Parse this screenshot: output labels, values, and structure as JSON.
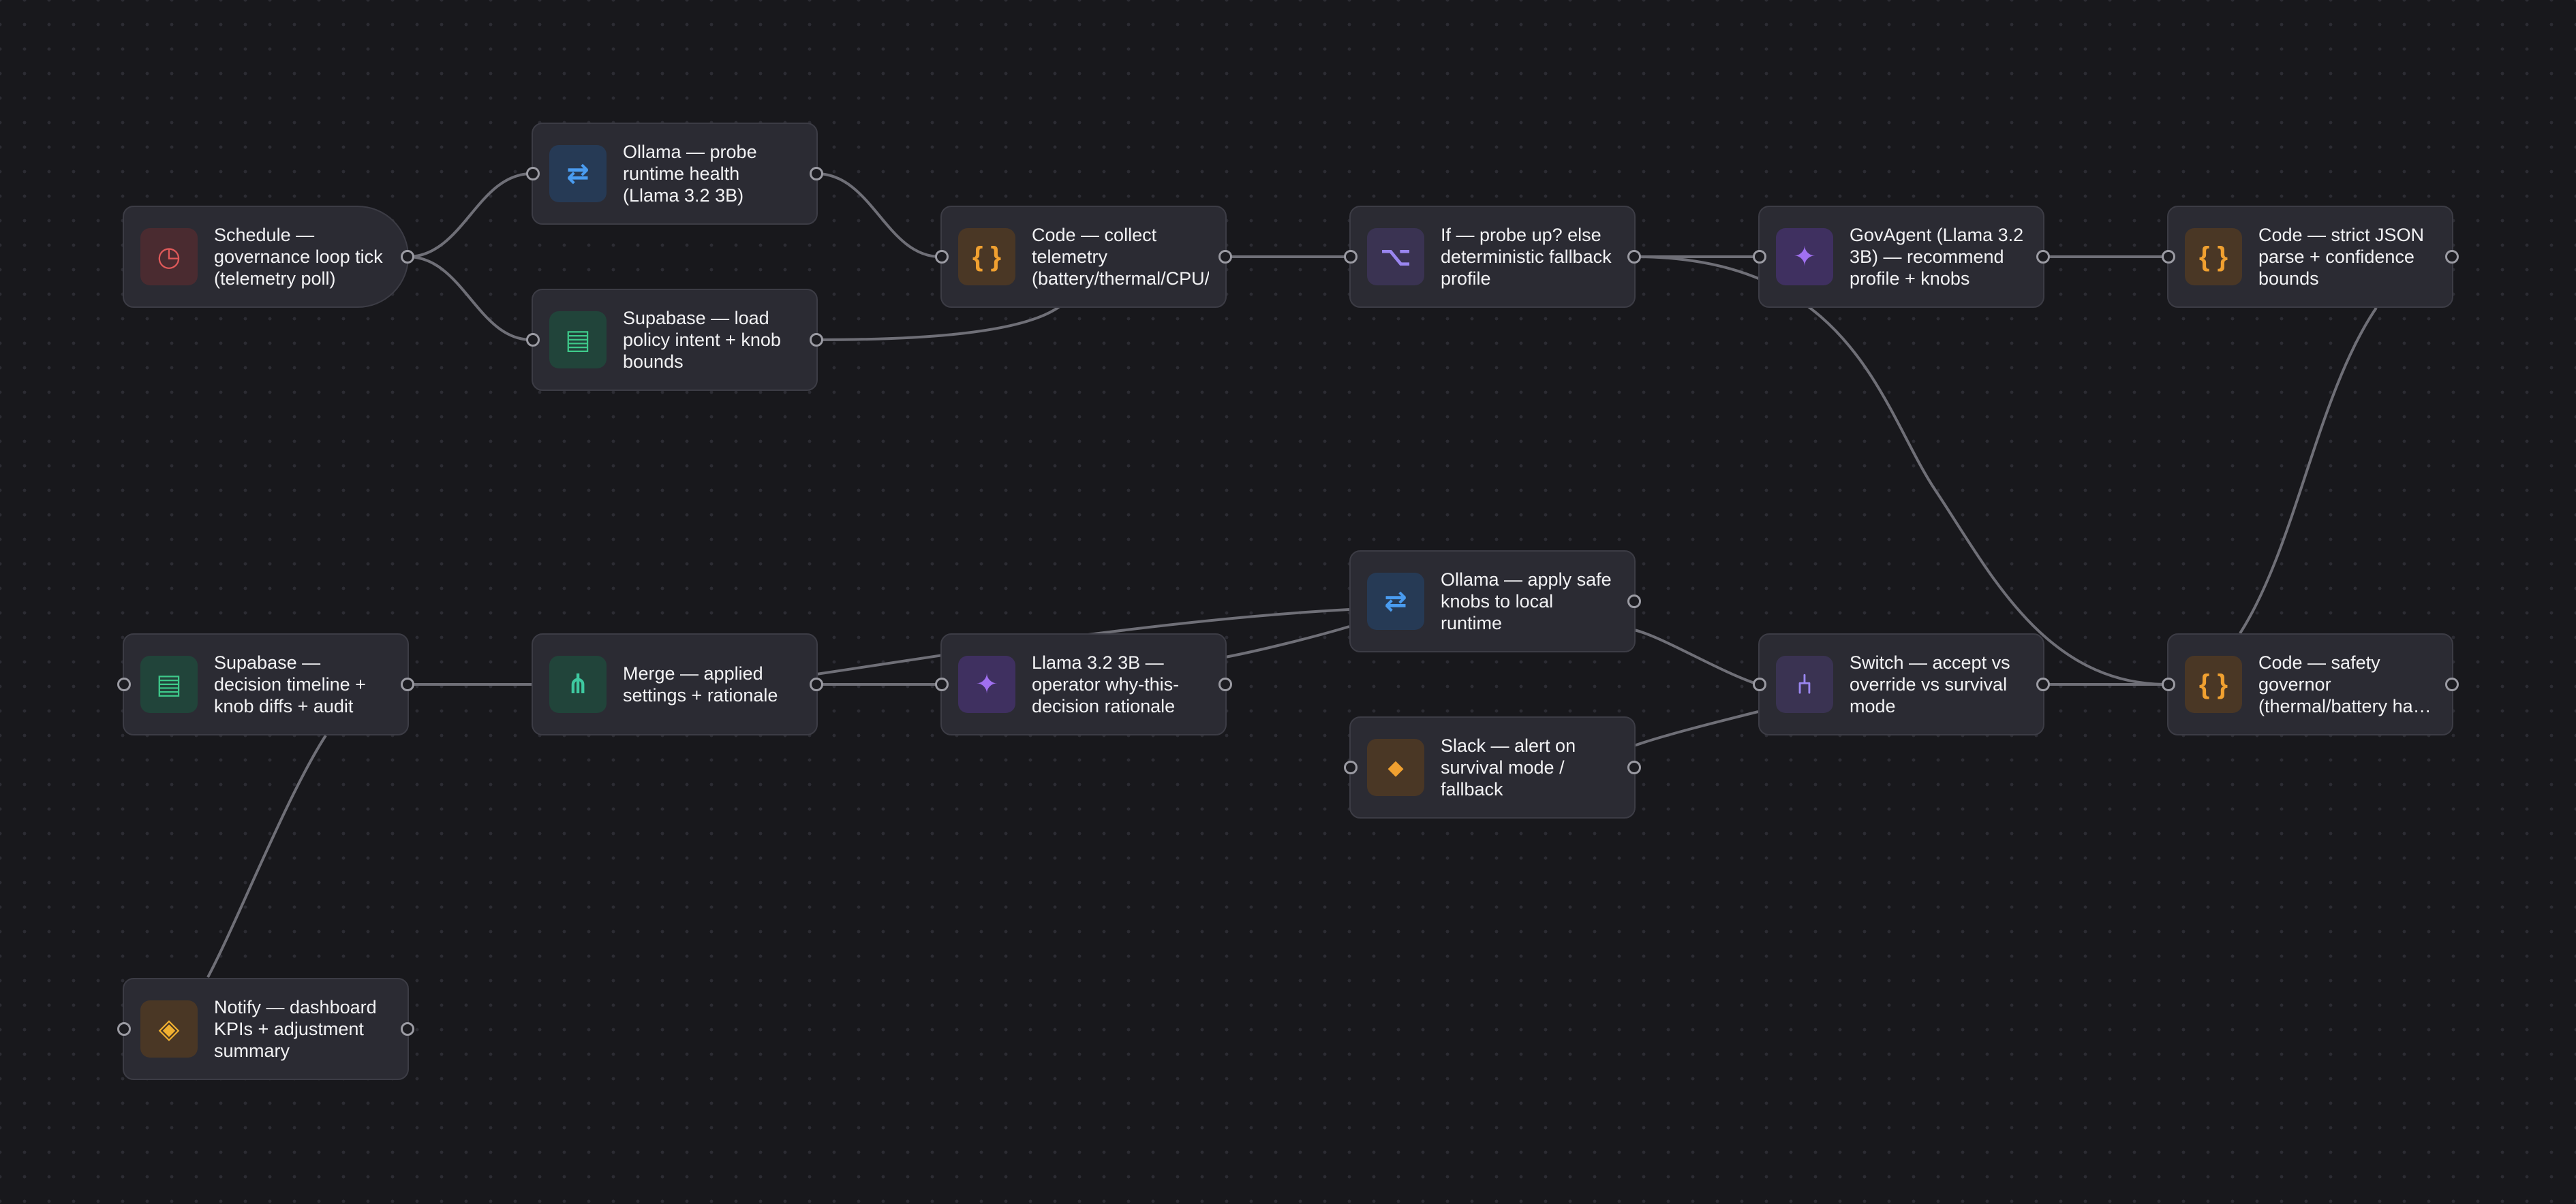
{
  "colors": {
    "background": "#18181c",
    "node_fill": "#2b2b33",
    "edge": "#6f6f77"
  },
  "nodes": [
    {
      "id": "schedule",
      "label": "Schedule — governance loop tick (telemetry poll)",
      "icon": "clock-icon",
      "glyph": "◷",
      "color": "#e05a5a",
      "bg": "#4a2b30",
      "trigger": true,
      "in_port": false
    },
    {
      "id": "ollama-probe",
      "label": "Ollama — probe runtime health (Llama 3.2 3B)",
      "icon": "arrows-exchange-icon",
      "glyph": "⇄",
      "color": "#4a9cf0",
      "bg": "#263a55",
      "in_port": true
    },
    {
      "id": "supabase-load",
      "label": "Supabase — load policy intent + knob bounds",
      "icon": "database-icon",
      "glyph": "▤",
      "color": "#3ec98a",
      "bg": "#21443a",
      "in_port": true
    },
    {
      "id": "code-telemetry",
      "label": "Code — collect telemetry (battery/thermal/CPU/r",
      "icon": "code-braces-icon",
      "glyph": "{ }",
      "color": "#f0a030",
      "bg": "#4a3725",
      "in_port": true
    },
    {
      "id": "if-probe",
      "label": "If — probe up? else deterministic fallback profile",
      "icon": "branch-icon",
      "glyph": "⌥",
      "color": "#9a86f0",
      "bg": "#3a3352",
      "in_port": true
    },
    {
      "id": "govagent",
      "label": "GovAgent (Llama 3.2 3B) — recommend profile + knobs",
      "icon": "sparkle-icon",
      "glyph": "✦",
      "color": "#a070f0",
      "bg": "#3f3060",
      "in_port": true
    },
    {
      "id": "code-json",
      "label": "Code — strict JSON parse + confidence bounds",
      "icon": "code-braces-icon",
      "glyph": "{ }",
      "color": "#f0a030",
      "bg": "#4a3725",
      "in_port": true
    },
    {
      "id": "ollama-apply",
      "label": "Ollama — apply safe knobs to local runtime",
      "icon": "arrows-exchange-icon",
      "glyph": "⇄",
      "color": "#4a9cf0",
      "bg": "#263a55",
      "in_port": false
    },
    {
      "id": "supabase-timeline",
      "label": "Supabase — decision timeline + knob diffs + audit",
      "icon": "database-icon",
      "glyph": "▤",
      "color": "#3ec98a",
      "bg": "#21443a",
      "in_port": true
    },
    {
      "id": "merge",
      "label": "Merge — applied settings + rationale",
      "icon": "merge-icon",
      "glyph": "⋔",
      "color": "#3ec9a0",
      "bg": "#21443a",
      "in_port": false
    },
    {
      "id": "llama-rationale",
      "label": "Llama 3.2 3B — operator why-this-decision rationale",
      "icon": "sparkle-icon",
      "glyph": "✦",
      "color": "#a070f0",
      "bg": "#3f3060",
      "in_port": true
    },
    {
      "id": "switch",
      "label": "Switch — accept vs override vs survival mode",
      "icon": "switch-icon",
      "glyph": "⑃",
      "color": "#9a86f0",
      "bg": "#3a3352",
      "in_port": true
    },
    {
      "id": "code-safety",
      "label": "Code — safety governor (thermal/battery hard caps)",
      "icon": "code-braces-icon",
      "glyph": "{ }",
      "color": "#f0a030",
      "bg": "#4a3725",
      "in_port": true
    },
    {
      "id": "slack",
      "label": "Slack — alert on survival mode / fallback",
      "icon": "slack-icon",
      "glyph": "◆",
      "color": "#f0a030",
      "bg": "#4a3725",
      "in_port": true
    },
    {
      "id": "notify",
      "label": "Notify — dashboard KPIs + adjustment summary",
      "icon": "notify-icon",
      "glyph": "◈",
      "color": "#f0b030",
      "bg": "#4a3725",
      "in_port": true
    }
  ]
}
